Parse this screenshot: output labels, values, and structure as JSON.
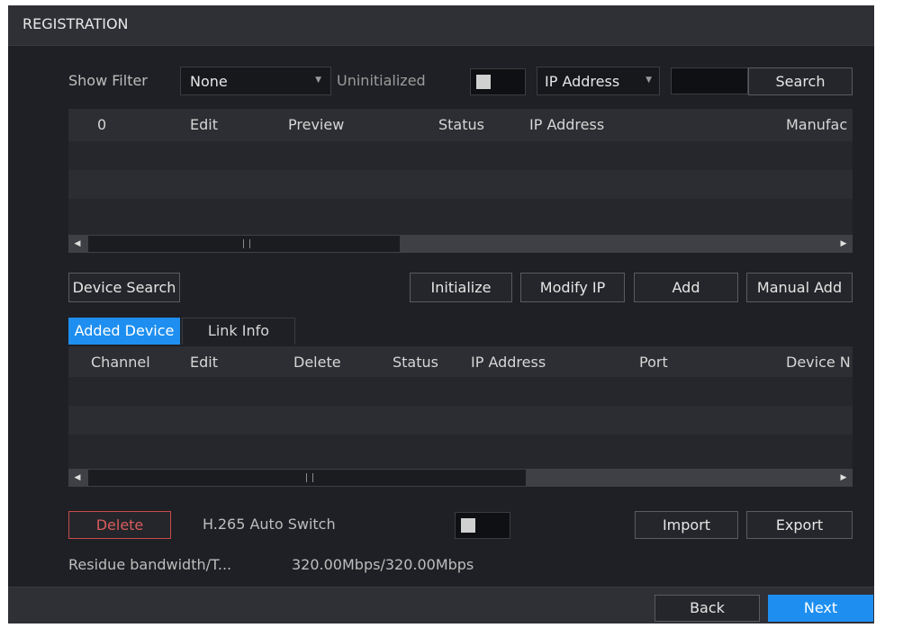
{
  "window": {
    "title": "REGISTRATION"
  },
  "filter": {
    "show_filter_label": "Show Filter",
    "show_filter_value": "None",
    "uninitialized_label": "Uninitialized",
    "search_type_value": "IP Address",
    "search_input_value": "",
    "search_button": "Search"
  },
  "search_table": {
    "columns": [
      "0",
      "Edit",
      "Preview",
      "Status",
      "IP Address",
      "Manufac"
    ],
    "rows": []
  },
  "actions": {
    "device_search": "Device Search",
    "initialize": "Initialize",
    "modify_ip": "Modify IP",
    "add": "Add",
    "manual_add": "Manual Add"
  },
  "tabs": [
    {
      "label": "Added Device",
      "active": true
    },
    {
      "label": "Link Info",
      "active": false
    }
  ],
  "added_table": {
    "columns": [
      "Channel",
      "Edit",
      "Delete",
      "Status",
      "IP Address",
      "Port",
      "Device N"
    ],
    "rows": []
  },
  "bottom": {
    "delete": "Delete",
    "h265_label": "H.265 Auto Switch",
    "h265_enabled": false,
    "import": "Import",
    "export": "Export",
    "bandwidth_label": "Residue bandwidth/T...",
    "bandwidth_value": "320.00Mbps/320.00Mbps"
  },
  "footer": {
    "back": "Back",
    "next": "Next"
  },
  "colors": {
    "accent": "#1e8ff0",
    "danger_border": "#c64a4a",
    "danger_text": "#d85c5c"
  },
  "icons": [
    "chevron-down-icon",
    "scroll-left-icon",
    "scroll-right-icon"
  ]
}
